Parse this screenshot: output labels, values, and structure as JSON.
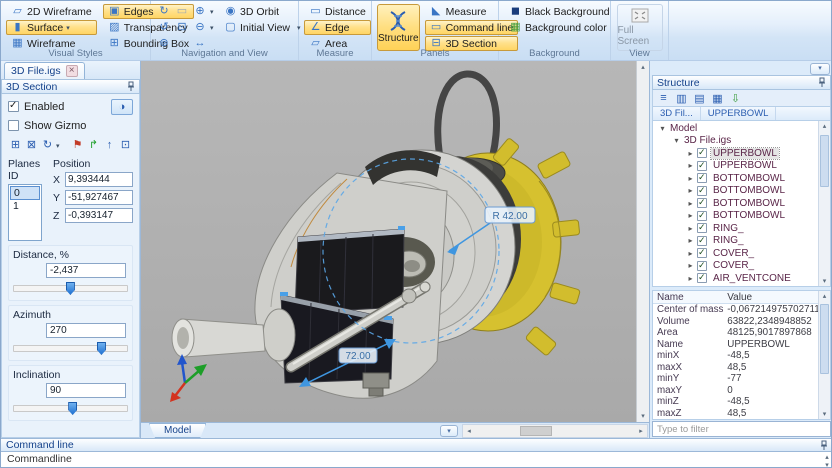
{
  "ribbon": {
    "visual_styles": {
      "label": "Visual Styles",
      "items": [
        "2D Wireframe",
        "Surface",
        "Wireframe",
        "Edges",
        "Transparency",
        "Bounding Box"
      ]
    },
    "navigation": {
      "label": "Navigation and View",
      "orbit_label": "3D Orbit",
      "initial_view_label": "Initial View"
    },
    "measure": {
      "label": "Measure",
      "items": [
        "Distance",
        "Edge",
        "Area"
      ]
    },
    "panels": {
      "label": "Panels",
      "structure_label": "Structure",
      "items": [
        "Measure",
        "Command line",
        "3D Section"
      ]
    },
    "background": {
      "label": "Background",
      "items": [
        "Black Background",
        "Background color"
      ]
    },
    "view": {
      "label": "View",
      "fullscreen_label": "Full Screen"
    }
  },
  "section_panel": {
    "tab_label": "3D File.igs",
    "title": "3D Section",
    "enabled_label": "Enabled",
    "show_gizmo_label": "Show Gizmo",
    "planes_label": "Planes ID",
    "planes": [
      "0",
      "1"
    ],
    "position_label": "Position",
    "axis_x": "X",
    "axis_y": "Y",
    "axis_z": "Z",
    "x_value": "9,393444",
    "y_value": "-51,927467",
    "z_value": "-0,393147",
    "distance_label": "Distance, %",
    "distance_value": "-2,437",
    "azimuth_label": "Azimuth",
    "azimuth_value": "270",
    "inclination_label": "Inclination",
    "inclination_value": "90"
  },
  "viewport": {
    "model_tab_label": "Model",
    "dim_radius": "R 42.00",
    "dim_length": "72.00"
  },
  "structure_panel": {
    "title": "Structure",
    "breadcrumb": [
      "3D Fil...",
      "UPPERBOWL"
    ],
    "tree": {
      "root_label": "Model",
      "file_label": "3D File.igs",
      "children": [
        "UPPERBOWL",
        "UPPERBOWL",
        "BOTTOMBOWL",
        "BOTTOMBOWL",
        "BOTTOMBOWL",
        "BOTTOMBOWL",
        "RING_",
        "RING_",
        "COVER_",
        "COVER_",
        "AIR_VENTCONE"
      ]
    },
    "properties": {
      "name_header": "Name",
      "value_header": "Value",
      "rows": [
        {
          "name": "Center of mass",
          "value": "-0,067214975702711..."
        },
        {
          "name": "Volume",
          "value": "63822,2348948852"
        },
        {
          "name": "Area",
          "value": "48125,9017897868"
        },
        {
          "name": "Name",
          "value": "UPPERBOWL"
        },
        {
          "name": "minX",
          "value": "-48,5"
        },
        {
          "name": "maxX",
          "value": "48,5"
        },
        {
          "name": "minY",
          "value": "-77"
        },
        {
          "name": "maxY",
          "value": "0"
        },
        {
          "name": "minZ",
          "value": "-48,5"
        },
        {
          "name": "maxZ",
          "value": "48,5"
        }
      ]
    },
    "filter_placeholder": "Type to filter"
  },
  "command_line": {
    "title": "Command line",
    "prompt": "Commandline"
  }
}
